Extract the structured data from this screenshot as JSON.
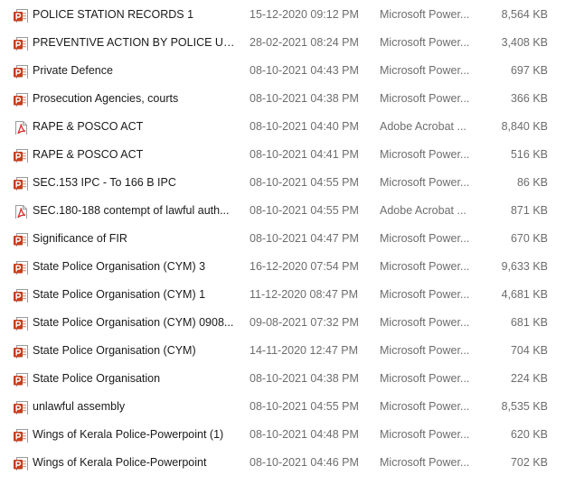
{
  "icons": {
    "pptx": {
      "name": "powerpoint-file-icon",
      "color": "#c43e1c"
    },
    "pdf": {
      "name": "pdf-file-icon",
      "color": "#d9302f"
    }
  },
  "files": [
    {
      "name": "POLICE STATION RECORDS 1",
      "date": "15-12-2020 09:12 PM",
      "type": "Microsoft Power...",
      "size": "8,564 KB",
      "icon": "pptx"
    },
    {
      "name": "PREVENTIVE ACTION BY POLICE UND...",
      "date": "28-02-2021 08:24 PM",
      "type": "Microsoft Power...",
      "size": "3,408 KB",
      "icon": "pptx"
    },
    {
      "name": "Private Defence",
      "date": "08-10-2021 04:43 PM",
      "type": "Microsoft Power...",
      "size": "697 KB",
      "icon": "pptx"
    },
    {
      "name": "Prosecution Agencies, courts",
      "date": "08-10-2021 04:38 PM",
      "type": "Microsoft Power...",
      "size": "366 KB",
      "icon": "pptx"
    },
    {
      "name": "RAPE & POSCO ACT",
      "date": "08-10-2021 04:40 PM",
      "type": "Adobe Acrobat ...",
      "size": "8,840 KB",
      "icon": "pdf"
    },
    {
      "name": "RAPE & POSCO ACT",
      "date": "08-10-2021 04:41 PM",
      "type": "Microsoft Power...",
      "size": "516 KB",
      "icon": "pptx"
    },
    {
      "name": "SEC.153 IPC -  To    166 B IPC",
      "date": "08-10-2021 04:55 PM",
      "type": "Microsoft Power...",
      "size": "86 KB",
      "icon": "pptx"
    },
    {
      "name": "SEC.180-188 contempt  of lawful auth...",
      "date": "08-10-2021 04:55 PM",
      "type": "Adobe Acrobat ...",
      "size": "871 KB",
      "icon": "pdf"
    },
    {
      "name": "Significance of FIR",
      "date": "08-10-2021 04:47 PM",
      "type": "Microsoft Power...",
      "size": "670 KB",
      "icon": "pptx"
    },
    {
      "name": "State Police Organisation (CYM)  3",
      "date": "16-12-2020 07:54 PM",
      "type": "Microsoft Power...",
      "size": "9,633 KB",
      "icon": "pptx"
    },
    {
      "name": "State Police Organisation (CYM) 1",
      "date": "11-12-2020 08:47 PM",
      "type": "Microsoft Power...",
      "size": "4,681 KB",
      "icon": "pptx"
    },
    {
      "name": "State Police Organisation (CYM) 0908...",
      "date": "09-08-2021 07:32 PM",
      "type": "Microsoft Power...",
      "size": "681 KB",
      "icon": "pptx"
    },
    {
      "name": "State Police Organisation (CYM)",
      "date": "14-11-2020 12:47 PM",
      "type": "Microsoft Power...",
      "size": "704 KB",
      "icon": "pptx"
    },
    {
      "name": "State Police Organisation",
      "date": "08-10-2021 04:38 PM",
      "type": "Microsoft Power...",
      "size": "224 KB",
      "icon": "pptx"
    },
    {
      "name": "unlawful assembly",
      "date": "08-10-2021 04:55 PM",
      "type": "Microsoft Power...",
      "size": "8,535 KB",
      "icon": "pptx"
    },
    {
      "name": "Wings of Kerala Police-Powerpoint (1)",
      "date": "08-10-2021 04:48 PM",
      "type": "Microsoft Power...",
      "size": "620 KB",
      "icon": "pptx"
    },
    {
      "name": "Wings of Kerala Police-Powerpoint",
      "date": "08-10-2021 04:46 PM",
      "type": "Microsoft Power...",
      "size": "702 KB",
      "icon": "pptx"
    }
  ]
}
